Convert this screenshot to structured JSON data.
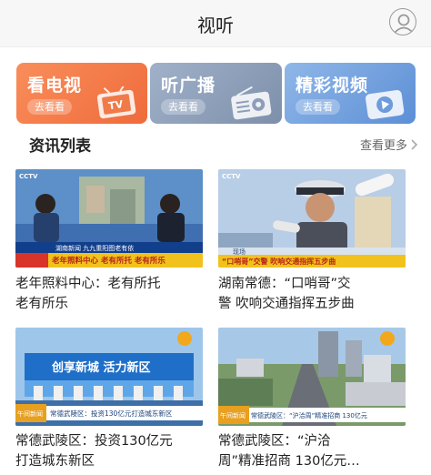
{
  "header": {
    "title": "视听"
  },
  "cards": [
    {
      "label": "看电视",
      "button": "去看看"
    },
    {
      "label": "听广播",
      "button": "去看看"
    },
    {
      "label": "精彩视频",
      "button": "去看看"
    }
  ],
  "section": {
    "title": "资讯列表",
    "more": "查看更多"
  },
  "news": [
    {
      "title": "老年照料中心：老有所托 老有所乐",
      "line1": "老年照料中心：老有所托",
      "line2": "老有所乐",
      "caption": "老年照料中心 老有所托 老有所乐",
      "ticker": "湖南新闻 九九重阳图老有依",
      "logo": "CCTV"
    },
    {
      "title": "湖南常德：“口哨哥”交警 吹响交通指挥五步曲",
      "line1": "湖南常德：“口哨哥”交",
      "line2": "警 吹响交通指挥五步曲",
      "caption": "“口哨哥”交警 吹响交通指挥五步曲",
      "ticker": "现场",
      "logo": "CCTV"
    },
    {
      "title": "常德武陵区：投资130亿元打造城东新区",
      "line1": "常德武陵区：投资130亿元",
      "line2": "打造城东新区",
      "banner": "创享新城 活力新区",
      "caption": "常德武陵区：投资130亿元打造城东新区",
      "tag": "午间新闻"
    },
    {
      "title": "常德武陵区：“沪洽周”精准招商 130亿元…",
      "line1": "常德武陵区：“沪洽",
      "line2": "周”精准招商 130亿元…",
      "caption": "常德武陵区：“沪洽周”精准招商 130亿元",
      "tag": "午间新闻"
    }
  ]
}
